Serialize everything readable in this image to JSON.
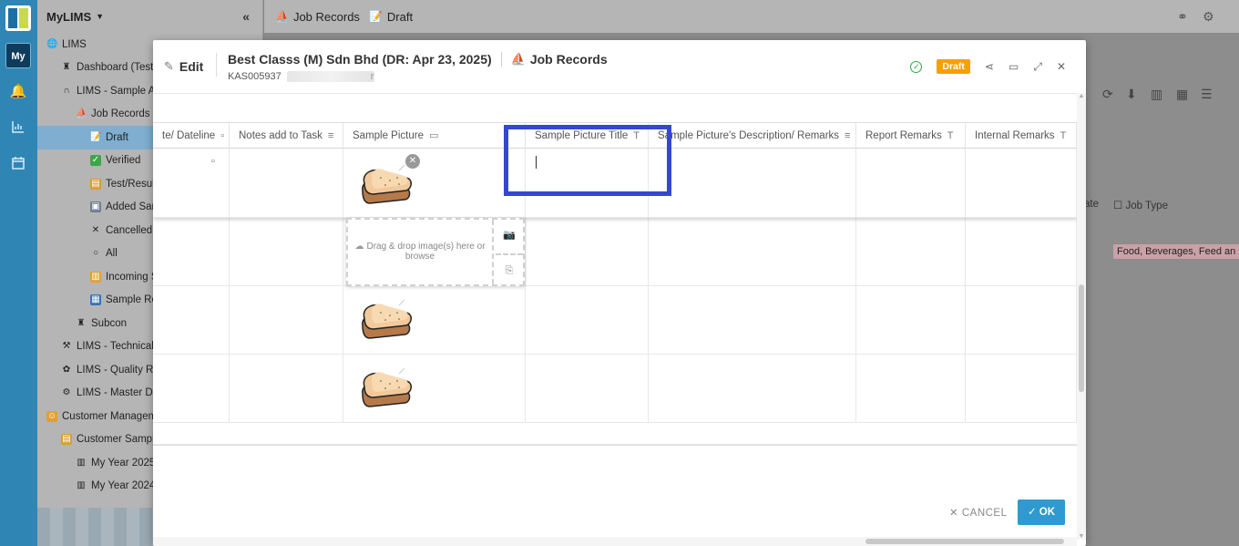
{
  "rail": {
    "workspace_badge": "My"
  },
  "sidebar": {
    "app_name": "MyLIMS",
    "items": [
      {
        "label": "LIMS",
        "indent": 0,
        "icon": "globe-icon"
      },
      {
        "label": "Dashboard (Testi",
        "indent": 1,
        "icon": "dashboard-icon"
      },
      {
        "label": "LIMS - Sample Ac",
        "indent": 1,
        "icon": "magnet-icon"
      },
      {
        "label": "Job Records",
        "indent": 2,
        "icon": "job-records-icon"
      },
      {
        "label": "Draft",
        "indent": 3,
        "icon": "draft-icon",
        "selected": true
      },
      {
        "label": "Verified",
        "indent": 3,
        "icon": "check-icon"
      },
      {
        "label": "Test/Resul",
        "indent": 3,
        "icon": "scroll-icon"
      },
      {
        "label": "Added Sam",
        "indent": 3,
        "icon": "image-icon"
      },
      {
        "label": "Cancelled",
        "indent": 3,
        "icon": "x-icon"
      },
      {
        "label": "All",
        "indent": 3,
        "icon": "circle-icon"
      },
      {
        "label": "Incoming S",
        "indent": 3,
        "icon": "book-icon"
      },
      {
        "label": "Sample Re",
        "indent": 3,
        "icon": "report-icon"
      },
      {
        "label": "Subcon",
        "indent": 2,
        "icon": "subcon-icon"
      },
      {
        "label": "LIMS - Technical",
        "indent": 1,
        "icon": "tools-icon"
      },
      {
        "label": "LIMS - Quality Re",
        "indent": 1,
        "icon": "flower-icon"
      },
      {
        "label": "LIMS - Master Da",
        "indent": 1,
        "icon": "gear-icon"
      },
      {
        "label": "Customer Managem",
        "indent": 0,
        "icon": "face-icon"
      },
      {
        "label": "Customer Sample",
        "indent": 1,
        "icon": "scroll-icon"
      },
      {
        "label": "My Year 2025",
        "indent": 2,
        "icon": "chart-icon"
      },
      {
        "label": "My Year 2024",
        "indent": 2,
        "icon": "chart-icon"
      }
    ]
  },
  "topbar": {
    "crumb1": "Job Records",
    "crumb2": "Draft"
  },
  "background": {
    "col_date_fragment": "ate",
    "col_job_type": "Job Type",
    "tag_job_type": "Food, Beverages, Feed an"
  },
  "modal": {
    "mode": "Edit",
    "title": "Best Classs (M) Sdn Bhd (DR: Apr 23, 2025)",
    "module": "Job Records",
    "record_id": "KAS005937",
    "record_suffix": "r",
    "status_badge": "Draft",
    "columns": [
      {
        "label": "te/ Dateline",
        "icon": "calendar-icon"
      },
      {
        "label": "Notes add to Task",
        "icon": "lines-icon"
      },
      {
        "label": "Sample Picture",
        "icon": "picture-icon"
      },
      {
        "label": "Sample Picture Title",
        "icon": "text-icon"
      },
      {
        "label": "Sample Picture's Description/ Remarks",
        "icon": "lines-icon"
      },
      {
        "label": "Report Remarks",
        "icon": "text-icon"
      },
      {
        "label": "Internal Remarks",
        "icon": "text-icon"
      }
    ],
    "dropzone_text": "Drag & drop image(s) here or browse",
    "cancel_label": "CANCEL",
    "ok_label": "OK"
  },
  "colors": {
    "rail": "#2f86b5",
    "accent": "#2e9ad0",
    "badge": "#f5a100",
    "highlight": "#3447d4"
  }
}
